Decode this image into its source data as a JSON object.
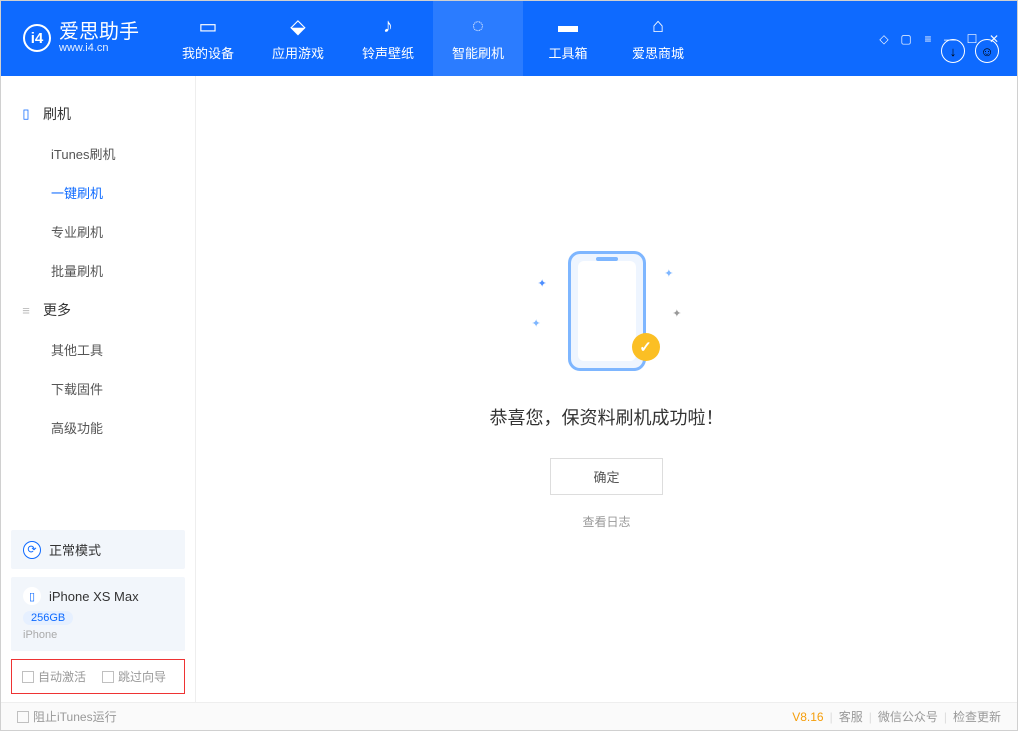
{
  "header": {
    "app_name_cn": "爱思助手",
    "app_name_en": "www.i4.cn",
    "tabs": [
      {
        "label": "我的设备",
        "active": false
      },
      {
        "label": "应用游戏",
        "active": false
      },
      {
        "label": "铃声壁纸",
        "active": false
      },
      {
        "label": "智能刷机",
        "active": true
      },
      {
        "label": "工具箱",
        "active": false
      },
      {
        "label": "爱思商城",
        "active": false
      }
    ]
  },
  "sidebar": {
    "group1": {
      "title": "刷机",
      "items": [
        {
          "label": "iTunes刷机",
          "active": false
        },
        {
          "label": "一键刷机",
          "active": true
        },
        {
          "label": "专业刷机",
          "active": false
        },
        {
          "label": "批量刷机",
          "active": false
        }
      ]
    },
    "group2": {
      "title": "更多",
      "items": [
        {
          "label": "其他工具",
          "active": false
        },
        {
          "label": "下载固件",
          "active": false
        },
        {
          "label": "高级功能",
          "active": false
        }
      ]
    },
    "mode_label": "正常模式",
    "device_name": "iPhone XS Max",
    "device_storage": "256GB",
    "device_type": "iPhone",
    "cb_auto": "自动激活",
    "cb_skip": "跳过向导"
  },
  "main": {
    "success_msg": "恭喜您，保资料刷机成功啦！",
    "ok_btn": "确定",
    "log_link": "查看日志"
  },
  "footer": {
    "cb_itunes": "阻止iTunes运行",
    "version": "V8.16",
    "link1": "客服",
    "link2": "微信公众号",
    "link3": "检查更新"
  }
}
